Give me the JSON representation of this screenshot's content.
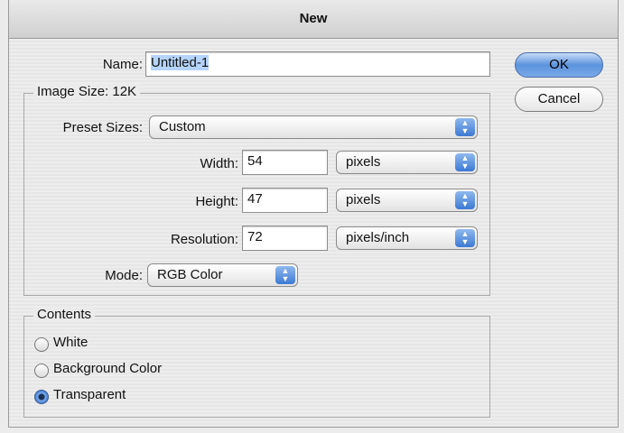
{
  "window": {
    "title": "New"
  },
  "name": {
    "label": "Name:",
    "value": "Untitled-1"
  },
  "buttons": {
    "ok": "OK",
    "cancel": "Cancel"
  },
  "image_size": {
    "legend": "Image Size: 12K",
    "preset": {
      "label": "Preset Sizes:",
      "value": "Custom"
    },
    "width": {
      "label": "Width:",
      "value": "54",
      "unit": "pixels"
    },
    "height": {
      "label": "Height:",
      "value": "47",
      "unit": "pixels"
    },
    "resolution": {
      "label": "Resolution:",
      "value": "72",
      "unit": "pixels/inch"
    },
    "mode": {
      "label": "Mode:",
      "value": "RGB Color"
    }
  },
  "contents": {
    "legend": "Contents",
    "options": [
      {
        "label": "White",
        "selected": false
      },
      {
        "label": "Background Color",
        "selected": false
      },
      {
        "label": "Transparent",
        "selected": true
      }
    ]
  },
  "icons": {
    "popup_arrow": "up-down-arrows-icon"
  },
  "colors": {
    "accent": "#3d79d3",
    "selection": "#b5d4fb"
  }
}
